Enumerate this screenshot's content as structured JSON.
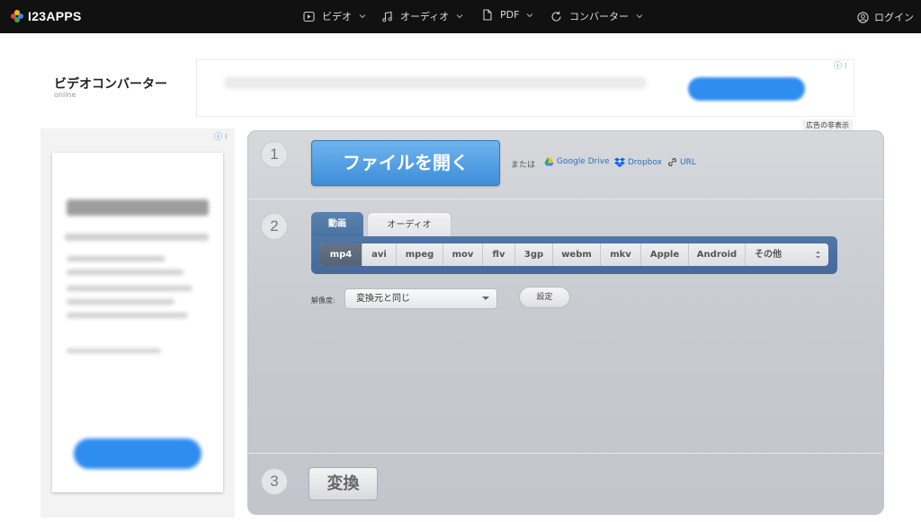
{
  "brand": {
    "logo_text": "I23APPS",
    "dot_colors": [
      "#e94235",
      "#fbbc05",
      "#34a853",
      "#4285f4"
    ]
  },
  "nav": {
    "items": [
      {
        "label": "ビデオ",
        "icon": "video-play-icon"
      },
      {
        "label": "オーディオ",
        "icon": "music-note-icon"
      },
      {
        "label": "PDF",
        "icon": "document-icon"
      },
      {
        "label": "コンバーター",
        "icon": "refresh-icon"
      }
    ],
    "login_label": "ログイン"
  },
  "header": {
    "title": "ビデオコンバーター",
    "subtitle": "online"
  },
  "ads": {
    "hide_label": "広告の非表示",
    "info_icon": "ⓘ ⁝"
  },
  "steps": {
    "step1_number": "1",
    "step2_number": "2",
    "step3_number": "3"
  },
  "step1": {
    "open_button": "ファイルを開く",
    "or_text": "または",
    "sources": [
      {
        "label": "Google Drive",
        "icon": "google-drive-icon",
        "color": "#2a6fc2"
      },
      {
        "label": "Dropbox",
        "icon": "dropbox-icon",
        "color": "#2a6fc2"
      },
      {
        "label": "URL",
        "icon": "link-icon",
        "color": "#2a6fc2"
      }
    ]
  },
  "step2": {
    "tabs": [
      {
        "label": "動画",
        "active": true
      },
      {
        "label": "オーディオ",
        "active": false
      }
    ],
    "formats": [
      "mp4",
      "avi",
      "mpeg",
      "mov",
      "flv",
      "3gp",
      "webm",
      "mkv",
      "Apple",
      "Android"
    ],
    "selected_format": "mp4",
    "more_label": "その他",
    "resolution_label": "解像度:",
    "resolution_value": "変換元と同じ",
    "settings_label": "設定"
  },
  "step3": {
    "convert_label": "変換"
  },
  "colors": {
    "topbar": "#111111",
    "accent_blue": "#3d8ed9",
    "format_bar": "#4f78a7"
  }
}
